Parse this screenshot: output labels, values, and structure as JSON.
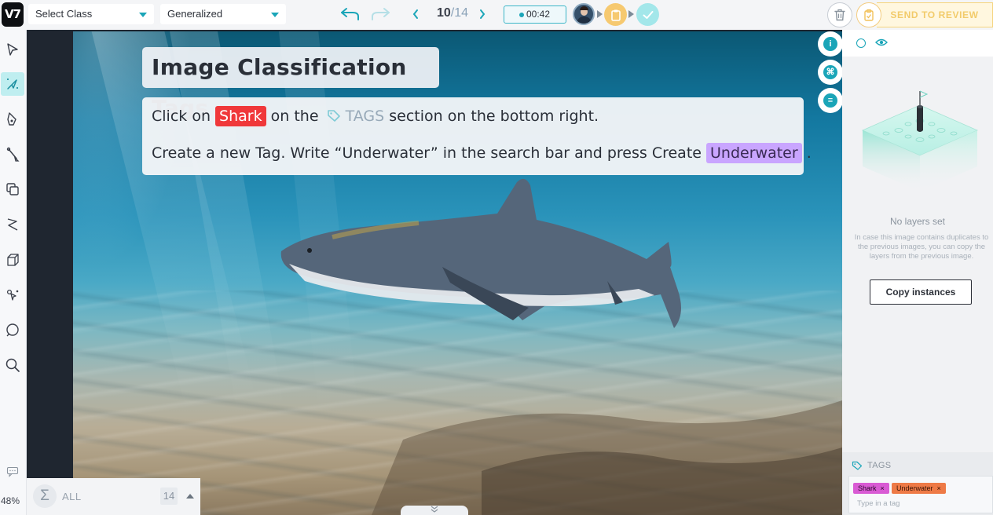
{
  "app": {
    "logo": "V7"
  },
  "toolbar": {
    "class_select": "Select Class",
    "mode_select": "Generalized",
    "image_index": "10",
    "image_total": "/14",
    "timer": "00:42",
    "send_to_review": "SEND TO REVIEW",
    "icons": {
      "undo": "undo-icon",
      "redo": "redo-icon",
      "prev": "chevron-left-icon",
      "next": "chevron-right-icon",
      "trash": "trash-icon",
      "clipboard": "clipboard-icon",
      "check": "check-icon"
    }
  },
  "left_tools": {
    "items": [
      "pointer-tool",
      "auto-annotate-tool",
      "polygon-tool",
      "brush-tool",
      "bounding-box-tool",
      "polyline-tool",
      "cuboid-tool",
      "keypoint-tool",
      "ellipse-tool",
      "zoom-tool"
    ],
    "active": "auto-annotate-tool",
    "zoom": "48%"
  },
  "canvas": {
    "title": "Image Classification Tags",
    "line1": {
      "a": "Click on",
      "tag1": "Shark",
      "b": "on the",
      "tags_word": "TAGS",
      "c": "section on the bottom right."
    },
    "line2": {
      "a": "Create a new Tag. Write “Underwater” in the search bar and press Create",
      "tag2": "Underwater",
      "b": "."
    }
  },
  "class_counter": {
    "label": "ALL",
    "sigma": "Σ",
    "count": "14"
  },
  "sidebar": {
    "no_layers": "No layers set",
    "description": "In case this image contains duplicates to the previous images, you can copy the layers from the previous image.",
    "copy_button": "Copy instances",
    "rail_info": "i",
    "tags": {
      "title": "TAGS",
      "chips": [
        {
          "label": "Shark",
          "color": "#d95bd4"
        },
        {
          "label": "Underwater",
          "color": "#ee7a46"
        }
      ],
      "placeholder": "Type in a tag"
    }
  },
  "colors": {
    "accent": "#1aa5b8",
    "review": "#f5d47e",
    "highlight_red": "#f0383a",
    "highlight_purple": "#c9a5ff"
  }
}
